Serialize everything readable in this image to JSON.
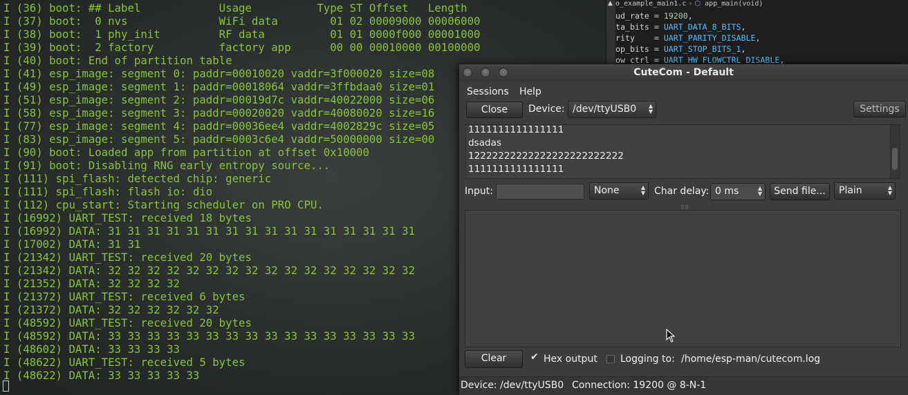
{
  "terminal": {
    "lines": [
      "I (36) boot: ## Label            Usage          Type ST Offset   Length",
      "I (37) boot:  0 nvs              WiFi data        01 02 00009000 00006000",
      "I (38) boot:  1 phy_init         RF data          01 01 0000f000 00001000",
      "I (39) boot:  2 factory          factory app      00 00 00010000 00100000",
      "I (40) boot: End of partition table",
      "I (41) esp_image: segment 0: paddr=00010020 vaddr=3f000020 size=08",
      "I (49) esp_image: segment 1: paddr=00018064 vaddr=3ffbdaa0 size=01",
      "I (51) esp_image: segment 2: paddr=00019d7c vaddr=40022000 size=06",
      "I (58) esp_image: segment 3: paddr=00020020 vaddr=40080020 size=16",
      "I (77) esp_image: segment 4: paddr=00036ee4 vaddr=4002829c size=05",
      "I (83) esp_image: segment 5: paddr=0003c6e4 vaddr=50000000 size=00",
      "I (90) boot: Loaded app from partition at offset 0x10000",
      "I (91) boot: Disabling RNG early entropy source...",
      "I (111) spi_flash: detected chip: generic",
      "I (111) spi_flash: flash io: dio",
      "I (112) cpu_start: Starting scheduler on PRO CPU.",
      "I (16992) UART_TEST: received 18 bytes",
      "I (16992) DATA: 31 31 31 31 31 31 31 31 31 31 31 31 31 31 31 31",
      "I (17002) DATA: 31 31",
      "I (21342) UART_TEST: received 20 bytes",
      "I (21342) DATA: 32 32 32 32 32 32 32 32 32 32 32 32 32 32 32 32",
      "I (21352) DATA: 32 32 32 32",
      "I (21372) UART_TEST: received 6 bytes",
      "I (21372) DATA: 32 32 32 32 32 32",
      "I (48592) UART_TEST: received 20 bytes",
      "I (48592) DATA: 33 33 33 33 33 33 33 33 33 33 33 33 33 33 33 33",
      "I (48602) DATA: 33 33 33 33",
      "I (48622) UART_TEST: received 5 bytes",
      "I (48622) DATA: 33 33 33 33 33"
    ]
  },
  "editor": {
    "tab_file": "o_example_main1.c",
    "tab_symbol": "app_main(void)",
    "lines": [
      {
        "pre": "ud_rate = ",
        "val": "19200",
        "post": ",",
        "kind": "num"
      },
      {
        "pre": "ta_bits = ",
        "val": "UART_DATA_8_BITS",
        "post": ",",
        "kind": "const"
      },
      {
        "pre": "rity    = ",
        "val": "UART_PARITY_DISABLE",
        "post": ",",
        "kind": "const"
      },
      {
        "pre": "op_bits = ",
        "val": "UART_STOP_BITS_1",
        "post": ",",
        "kind": "const"
      },
      {
        "pre": "ow_ctrl = ",
        "val": "UART_HW_FLOWCTRL_DISABLE",
        "post": ",",
        "kind": "const"
      }
    ]
  },
  "cutecom": {
    "title": "CuteCom - Default",
    "menu": {
      "sessions": "Sessions",
      "help": "Help"
    },
    "close_label": "Close",
    "device_label": "Device:",
    "device_value": "/dev/ttyUSB0",
    "settings_label": "Settings",
    "output_lines": [
      "1111111111111111",
      "dsadas",
      "12222222222222222222222222",
      "1111111111111111"
    ],
    "input_label": "Input:",
    "input_value": "",
    "line_end_value": "None",
    "char_delay_label": "Char delay:",
    "char_delay_value": "0 ms",
    "send_file_label": "Send file...",
    "format_value": "Plain",
    "clear_label": "Clear",
    "hex_output_label": "Hex output",
    "hex_output_checked": true,
    "logging_label": "Logging to:",
    "logging_checked": false,
    "log_path": "/home/esp-man/cutecom.log",
    "status_device": "Device:  /dev/ttyUSB0",
    "status_connection": "Connection:  19200 @ 8-N-1"
  },
  "colors": {
    "terminal_text": "#8ac33a",
    "window_bg": "#3d3d3d"
  }
}
